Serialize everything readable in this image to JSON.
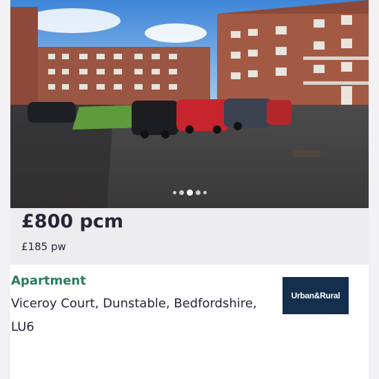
{
  "listing": {
    "price": "£800 pcm",
    "weekly_price": "£185 pw",
    "property_type": "Apartment",
    "address": "Viceroy Court, Dunstable, Bedfordshire, LU6",
    "agent_logo_text": "Urban&Rural"
  },
  "gallery": {
    "photo_description": "Block of brick flats around a car park",
    "dot_count": 5,
    "active_dot": 3
  },
  "colors": {
    "accent_green": "#2d7d5c",
    "logo_bg": "#142f4e",
    "price_panel_bg": "#ededf0",
    "text": "#262637"
  }
}
